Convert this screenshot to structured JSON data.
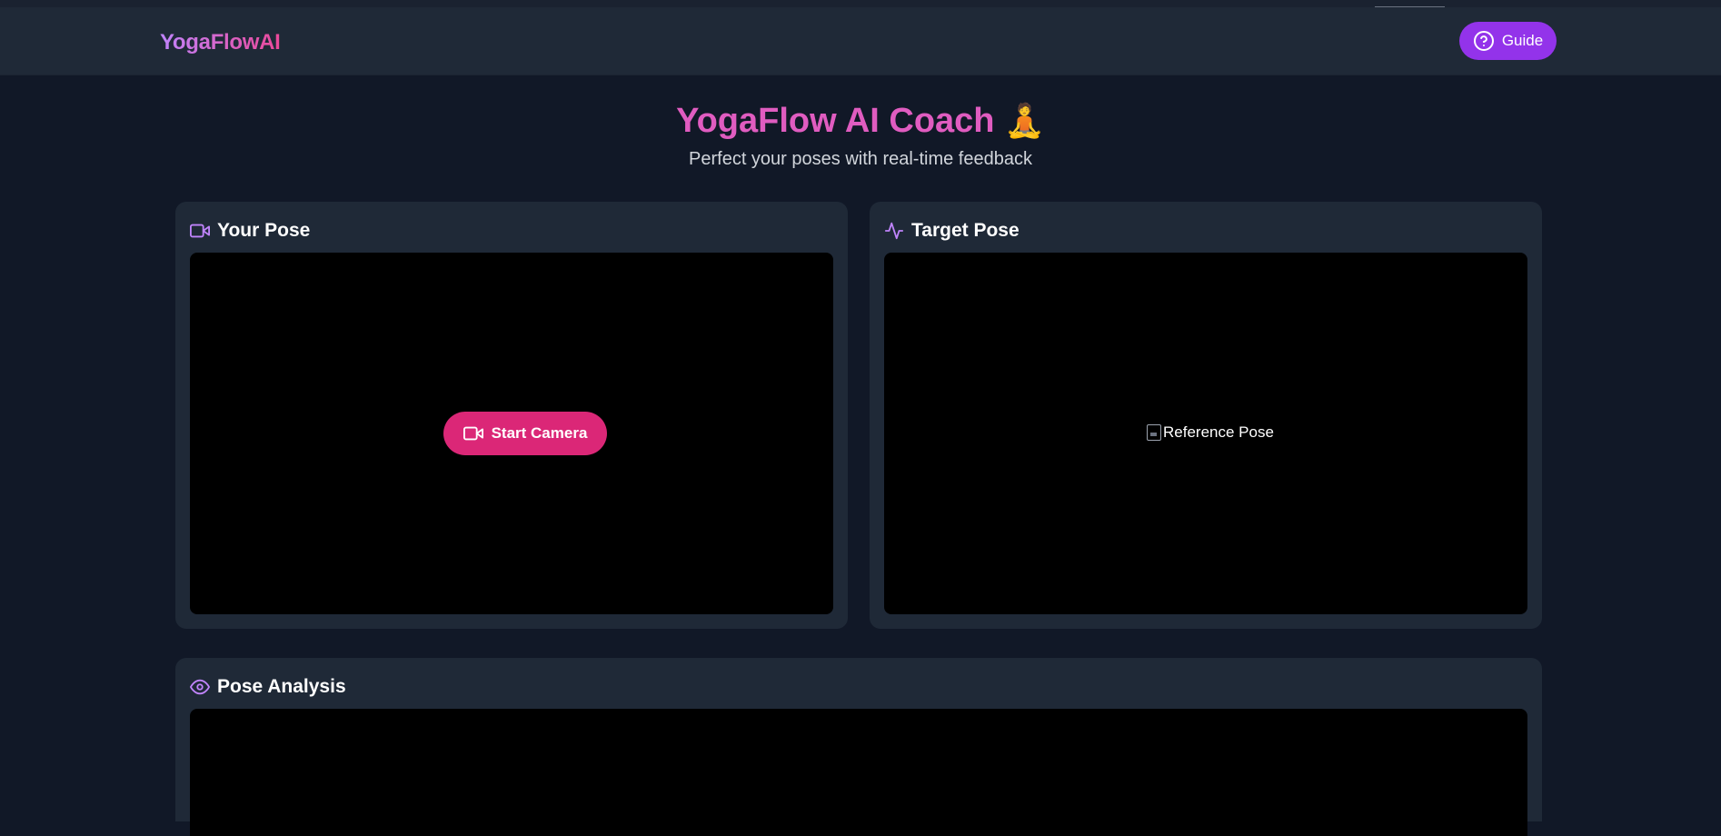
{
  "navbar": {
    "brand": "YogaFlowAI",
    "guide_label": "Guide"
  },
  "hero": {
    "title": "YogaFlow AI Coach",
    "emoji": "🧘",
    "subtitle": "Perfect your poses with real-time feedback"
  },
  "panels": {
    "your_pose": {
      "title": "Your Pose",
      "start_camera_label": "Start Camera"
    },
    "target_pose": {
      "title": "Target Pose",
      "image_alt": "Reference Pose"
    },
    "analysis": {
      "title": "Pose Analysis"
    }
  },
  "icons": {
    "guide": "help-circle-icon",
    "your_pose": "video-camera-icon",
    "target_pose": "activity-icon",
    "analysis": "eye-icon",
    "start_camera": "video-camera-icon"
  },
  "colors": {
    "background": "#111827",
    "card": "#1f2937",
    "accent_purple": "#9333ea",
    "accent_pink": "#db2777",
    "title_pink": "#e05cc0"
  }
}
